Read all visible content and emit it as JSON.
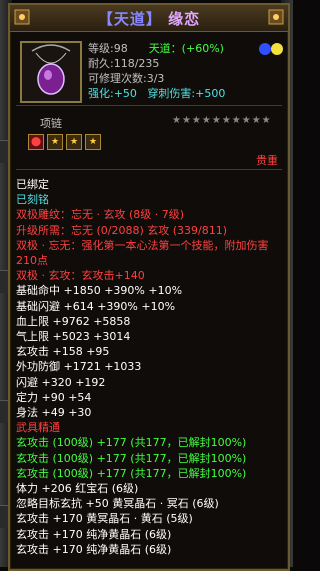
{
  "title": {
    "bracket_left": "【",
    "realm": "天道",
    "bracket_right": "】",
    "name": "缘恋"
  },
  "level": "等级:98",
  "tiandao": "天道：(+60%)",
  "durability": "耐久:118/235",
  "repair": "可修理次数:3/3",
  "enhance": {
    "label": "强化:",
    "value": "+50"
  },
  "pierce": {
    "label": "穿刺伤害:",
    "value": "+500"
  },
  "chain_label": "项链",
  "stars": "★★★★★★★★★★",
  "chain_boxes": [
    "⬤",
    "★",
    "★",
    "★"
  ],
  "precious": "贵重",
  "lines": [
    {
      "cls": "white",
      "text": "已绑定"
    },
    {
      "cls": "cyan",
      "text": "已刻铭"
    },
    {
      "cls": "red",
      "text": "双极雕纹：忘无 · 玄攻 (8级 · 7级)"
    },
    {
      "cls": "red",
      "text": "升级所需：忘无 (0/2088)   玄攻 (339/811)"
    },
    {
      "cls": "red wrap",
      "text": "双极 · 忘无：强化第一本心法第一个技能，附加伤害210点"
    },
    {
      "cls": "red",
      "text": "双极 · 玄攻：玄攻击+140"
    },
    {
      "cls": "white",
      "text": "基础命中 +1850  +390% +10%"
    },
    {
      "cls": "white",
      "text": "基础闪避 +614  +390% +10%"
    },
    {
      "cls": "white",
      "text": "血上限 +9762  +5858"
    },
    {
      "cls": "white",
      "text": "气上限 +5023  +3014"
    },
    {
      "cls": "white",
      "text": "玄攻击 +158  +95"
    },
    {
      "cls": "white",
      "text": "外功防御 +1721  +1033"
    },
    {
      "cls": "white",
      "text": "闪避 +320  +192"
    },
    {
      "cls": "white",
      "text": "定力 +90  +54"
    },
    {
      "cls": "white",
      "text": "身法 +49  +30"
    },
    {
      "cls": "red",
      "text": "武具精通"
    },
    {
      "cls": "green",
      "text": "玄攻击 (100级) +177 (共177，已解封100%)"
    },
    {
      "cls": "green",
      "text": "玄攻击 (100级) +177 (共177，已解封100%)"
    },
    {
      "cls": "green",
      "text": "玄攻击 (100级) +177 (共177，已解封100%)"
    },
    {
      "cls": "white",
      "text": "体力 +206  红宝石 (6级)"
    },
    {
      "cls": "white",
      "text": "忽略目标玄抗 +50  黄冥晶石 · 冥石 (6级)"
    },
    {
      "cls": "white",
      "text": "玄攻击 +170  黄冥晶石 · 黄石 (5级)"
    },
    {
      "cls": "white",
      "text": "玄攻击 +170  纯净黄晶石 (6级)"
    },
    {
      "cls": "white",
      "text": "玄攻击 +170  纯净黄晶石 (6级)"
    }
  ]
}
